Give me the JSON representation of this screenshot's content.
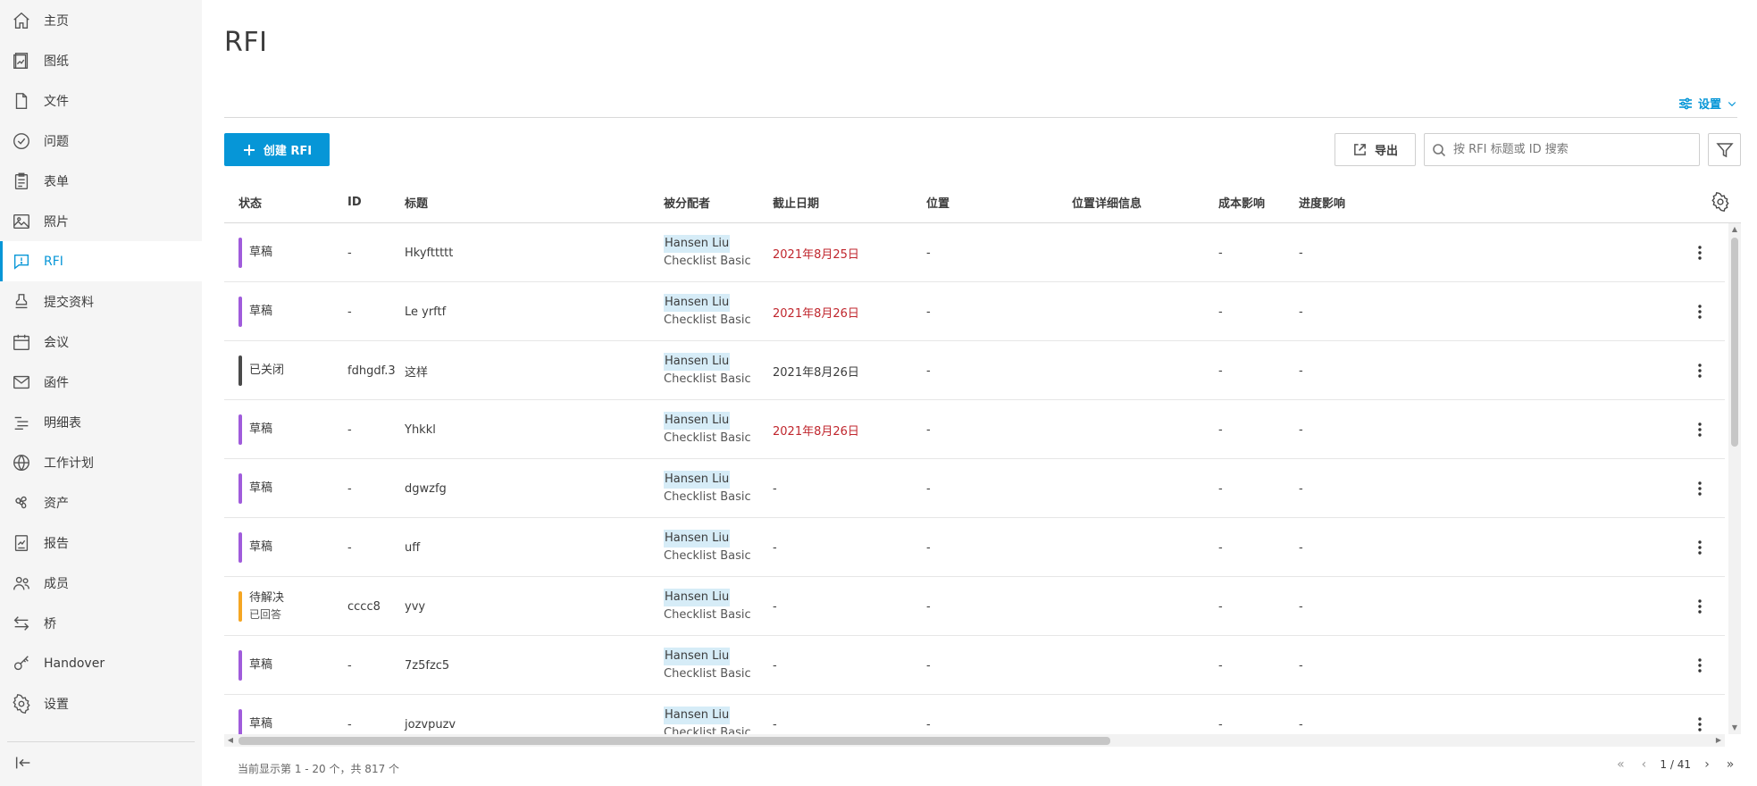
{
  "sidebar": {
    "items": [
      {
        "label": "主页",
        "icon": "home-icon"
      },
      {
        "label": "图纸",
        "icon": "sheets-icon"
      },
      {
        "label": "文件",
        "icon": "file-icon"
      },
      {
        "label": "问题",
        "icon": "issue-check-icon"
      },
      {
        "label": "表单",
        "icon": "clipboard-icon"
      },
      {
        "label": "照片",
        "icon": "photo-icon"
      },
      {
        "label": "RFI",
        "icon": "rfi-chat-icon",
        "active": true
      },
      {
        "label": "提交资料",
        "icon": "stamp-icon"
      },
      {
        "label": "会议",
        "icon": "calendar-icon"
      },
      {
        "label": "函件",
        "icon": "mail-icon"
      },
      {
        "label": "明细表",
        "icon": "list-icon"
      },
      {
        "label": "工作计划",
        "icon": "globe-icon"
      },
      {
        "label": "资产",
        "icon": "asset-fan-icon"
      },
      {
        "label": "报告",
        "icon": "report-icon"
      },
      {
        "label": "成员",
        "icon": "members-icon"
      },
      {
        "label": "桥",
        "icon": "bridge-arrows-icon"
      },
      {
        "label": "Handover",
        "icon": "key-icon"
      },
      {
        "label": "设置",
        "icon": "gear-icon"
      }
    ]
  },
  "page": {
    "title": "RFI",
    "settings_label": "设置",
    "create_label": "创建 RFI",
    "export_label": "导出",
    "search_placeholder": "按 RFI 标题或 ID 搜索"
  },
  "table": {
    "columns": [
      "状态",
      "ID",
      "标题",
      "被分配者",
      "截止日期",
      "位置",
      "位置详细信息",
      "成本影响",
      "进度影响"
    ],
    "rows": [
      {
        "status": "草稿",
        "status_sub": "",
        "status_color": "#a05cdb",
        "id": "-",
        "title": "Hkyfttttt",
        "assignee": "Hansen Liu",
        "team": "Checklist Basic",
        "due": "2021年8月25日",
        "overdue": true,
        "location": "-",
        "location_detail": "",
        "cost": "-",
        "schedule": "-"
      },
      {
        "status": "草稿",
        "status_sub": "",
        "status_color": "#a05cdb",
        "id": "-",
        "title": "Le yrftf",
        "assignee": "Hansen Liu",
        "team": "Checklist Basic",
        "due": "2021年8月26日",
        "overdue": true,
        "location": "-",
        "location_detail": "",
        "cost": "-",
        "schedule": "-"
      },
      {
        "status": "已关闭",
        "status_sub": "",
        "status_color": "#4a4a4a",
        "id": "fdhgdf.3",
        "title": "这样",
        "assignee": "Hansen Liu",
        "team": "Checklist Basic",
        "due": "2021年8月26日",
        "overdue": false,
        "location": "-",
        "location_detail": "",
        "cost": "-",
        "schedule": "-"
      },
      {
        "status": "草稿",
        "status_sub": "",
        "status_color": "#a05cdb",
        "id": "-",
        "title": "Yhkkl",
        "assignee": "Hansen Liu",
        "team": "Checklist Basic",
        "due": "2021年8月26日",
        "overdue": true,
        "location": "-",
        "location_detail": "",
        "cost": "-",
        "schedule": "-"
      },
      {
        "status": "草稿",
        "status_sub": "",
        "status_color": "#a05cdb",
        "id": "-",
        "title": "dgwzfg",
        "assignee": "Hansen Liu",
        "team": "Checklist Basic",
        "due": "-",
        "overdue": false,
        "location": "-",
        "location_detail": "",
        "cost": "-",
        "schedule": "-"
      },
      {
        "status": "草稿",
        "status_sub": "",
        "status_color": "#a05cdb",
        "id": "-",
        "title": "uff",
        "assignee": "Hansen Liu",
        "team": "Checklist Basic",
        "due": "-",
        "overdue": false,
        "location": "-",
        "location_detail": "",
        "cost": "-",
        "schedule": "-"
      },
      {
        "status": "待解决",
        "status_sub": "已回答",
        "status_color": "#f5a623",
        "id": "cccc8",
        "title": "yvy",
        "assignee": "Hansen Liu",
        "team": "Checklist Basic",
        "due": "-",
        "overdue": false,
        "location": "-",
        "location_detail": "",
        "cost": "-",
        "schedule": "-"
      },
      {
        "status": "草稿",
        "status_sub": "",
        "status_color": "#a05cdb",
        "id": "-",
        "title": "7z5fzc5",
        "assignee": "Hansen Liu",
        "team": "Checklist Basic",
        "due": "-",
        "overdue": false,
        "location": "-",
        "location_detail": "",
        "cost": "-",
        "schedule": "-"
      },
      {
        "status": "草稿",
        "status_sub": "",
        "status_color": "#a05cdb",
        "id": "-",
        "title": "jozvpuzv",
        "assignee": "Hansen Liu",
        "team": "Checklist Basic",
        "due": "-",
        "overdue": false,
        "location": "-",
        "location_detail": "",
        "cost": "-",
        "schedule": "-"
      }
    ]
  },
  "footer": {
    "count_text": "当前显示第 1 - 20 个，共 817 个",
    "page_text": "1 / 41"
  },
  "colors": {
    "accent": "#0696d7",
    "overdue": "#c0262d",
    "draft": "#a05cdb",
    "closed": "#4a4a4a",
    "pending": "#f5a623"
  }
}
